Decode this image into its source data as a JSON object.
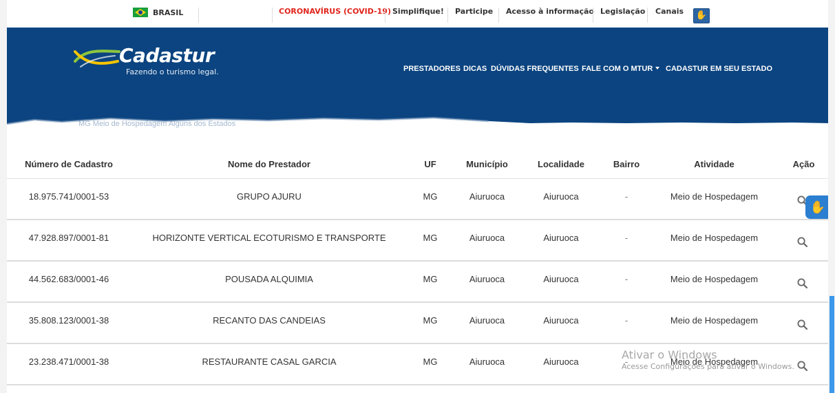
{
  "govbar": {
    "brasil": "BRASIL",
    "covid": "CORONAVÍRUS (COVID-19)",
    "simplifique": "Simplifique!",
    "participe": "Participe",
    "acesso": "Acesso à informação",
    "legislacao": "Legislação",
    "canais": "Canais",
    "vlibras_icon": "hand-sign-icon"
  },
  "header": {
    "logo_name": "Cadastur",
    "tagline": "Fazendo o turismo legal.",
    "nav": {
      "prestadores": "PRESTADORES",
      "dicas": "DICAS",
      "duvidas": "DÚVIDAS FREQUENTES",
      "fale": "FALE COM O MTUR",
      "cadastur_estado": "CADASTUR EM SEU ESTADO"
    },
    "breadcrumb_ghost": "MG        Meio de Hospedagem         Alguns dos Estados"
  },
  "table": {
    "columns": [
      "Número de Cadastro",
      "Nome do Prestador",
      "UF",
      "Município",
      "Localidade",
      "Bairro",
      "Atividade",
      "Ação"
    ],
    "rows": [
      [
        "18.975.741/0001-53",
        "GRUPO AJURU",
        "MG",
        "Aiuruoca",
        "Aiuruoca",
        "-",
        "Meio de Hospedagem"
      ],
      [
        "47.928.897/0001-81",
        "HORIZONTE VERTICAL ECOTURISMO E TRANSPORTE",
        "MG",
        "Aiuruoca",
        "Aiuruoca",
        "-",
        "Meio de Hospedagem"
      ],
      [
        "44.562.683/0001-46",
        "POUSADA ALQUIMIA",
        "MG",
        "Aiuruoca",
        "Aiuruoca",
        "-",
        "Meio de Hospedagem"
      ],
      [
        "35.808.123/0001-38",
        "RECANTO DAS CANDEIAS",
        "MG",
        "Aiuruoca",
        "Aiuruoca",
        "-",
        "Meio de Hospedagem"
      ],
      [
        "23.238.471/0001-38",
        "RESTAURANTE CASAL GARCIA",
        "MG",
        "Aiuruoca",
        "Aiuruoca",
        "-",
        "Meio de Hospedagem"
      ]
    ]
  },
  "watermark": {
    "title": "Ativar o Windows",
    "subtitle": "Acesse Configurações para ativar o Windows."
  },
  "colors": {
    "header_blue": "#0b4480",
    "covid_red": "#e0241b",
    "accent_blue": "#2c7fd0"
  }
}
